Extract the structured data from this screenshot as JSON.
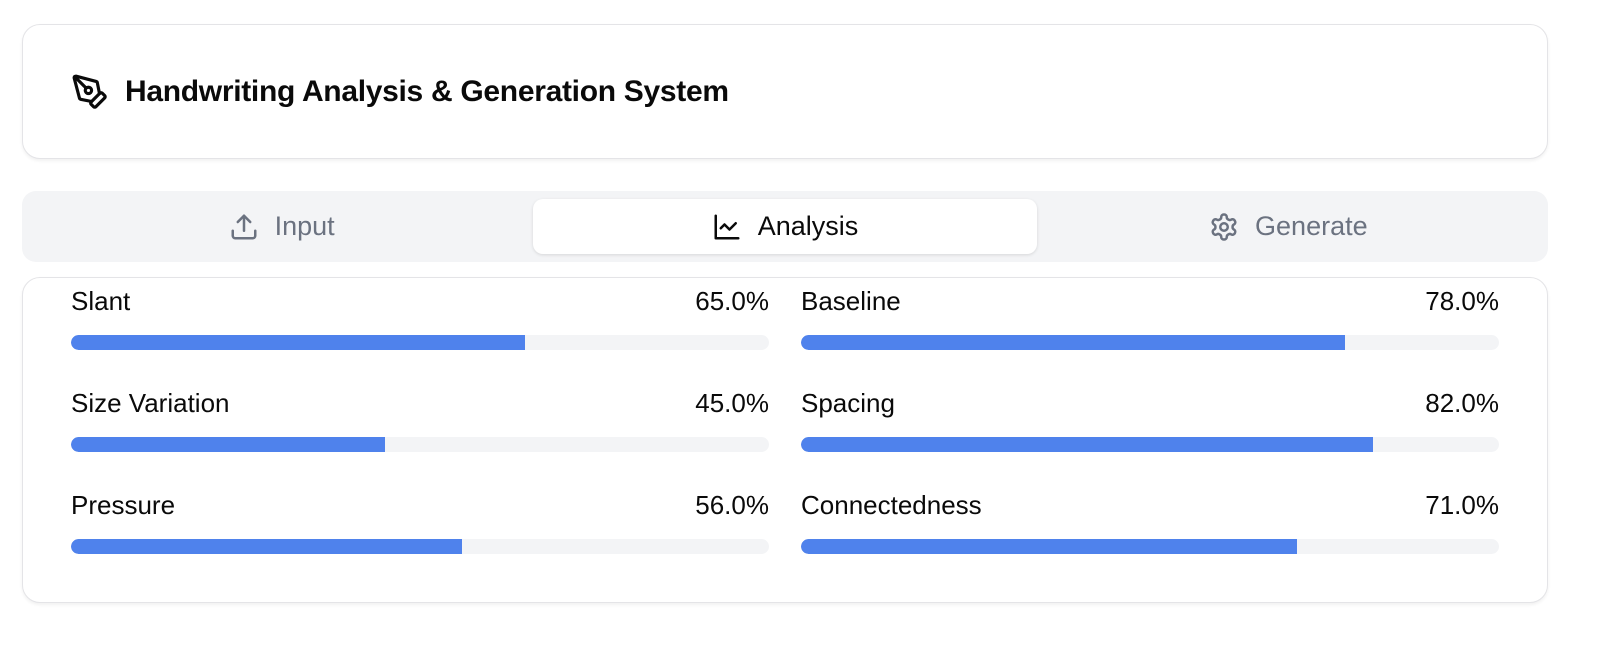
{
  "header": {
    "icon": "pen-tool-icon",
    "title": "Handwriting Analysis & Generation System"
  },
  "tabs": [
    {
      "label": "Input",
      "icon": "upload-icon",
      "active": false
    },
    {
      "label": "Analysis",
      "icon": "line-chart-icon",
      "active": true
    },
    {
      "label": "Generate",
      "icon": "settings-icon",
      "active": false
    }
  ],
  "metrics": [
    {
      "label": "Slant",
      "value": "65.0%",
      "fraction": 0.65
    },
    {
      "label": "Baseline",
      "value": "78.0%",
      "fraction": 0.78
    },
    {
      "label": "Size Variation",
      "value": "45.0%",
      "fraction": 0.45
    },
    {
      "label": "Spacing",
      "value": "82.0%",
      "fraction": 0.82
    },
    {
      "label": "Pressure",
      "value": "56.0%",
      "fraction": 0.56
    },
    {
      "label": "Connectedness",
      "value": "71.0%",
      "fraction": 0.71
    }
  ],
  "colors": {
    "accent": "#4f82ec",
    "track": "#f3f4f6",
    "muted_text": "#6b7280"
  }
}
